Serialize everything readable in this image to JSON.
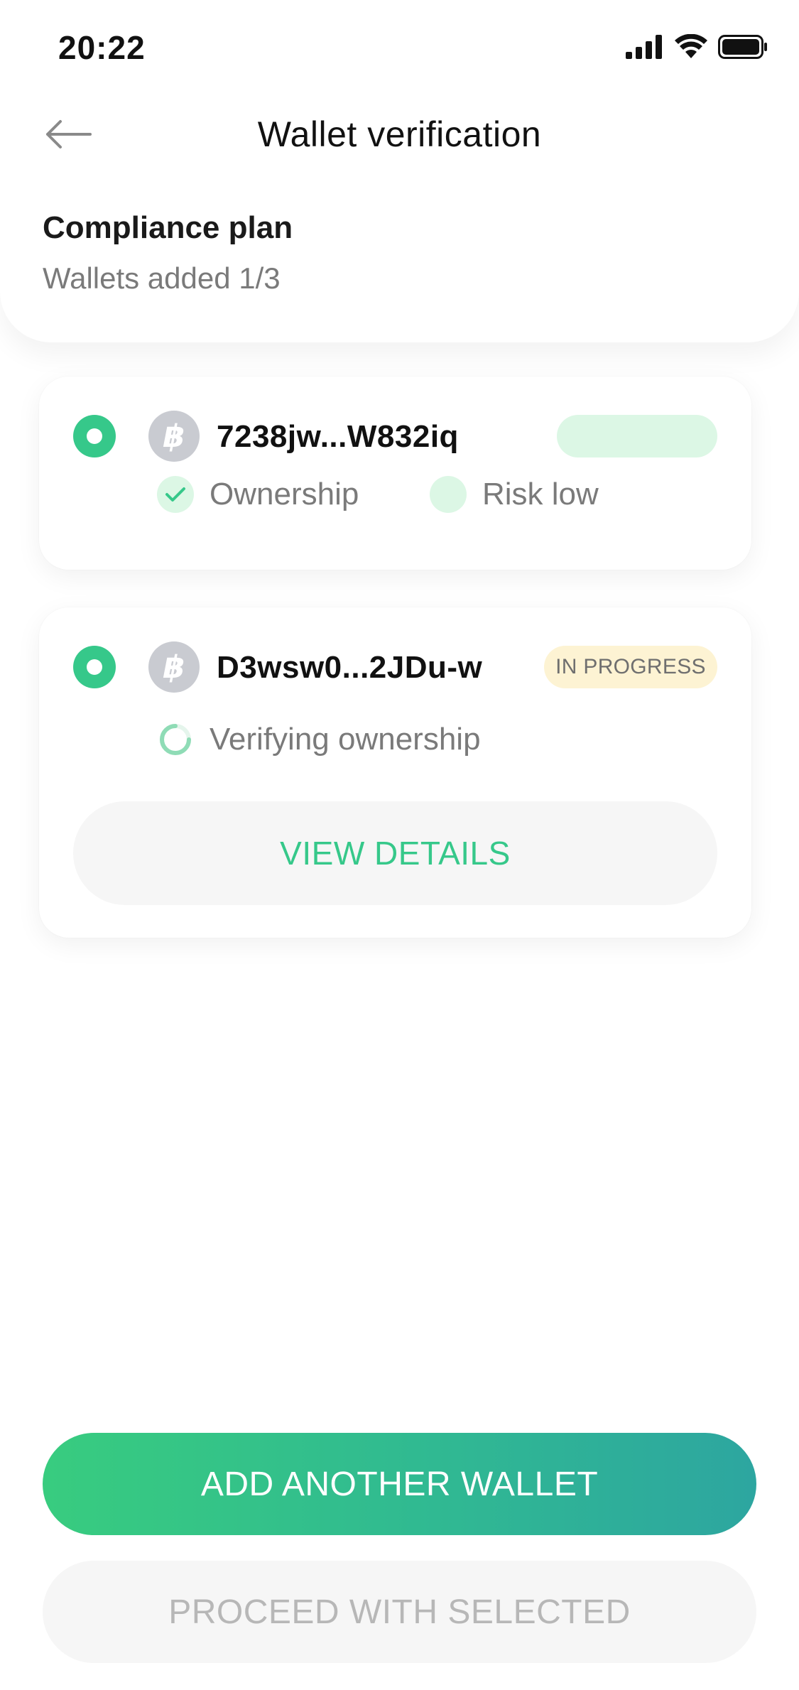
{
  "status_bar": {
    "time": "20:22",
    "icons": [
      "signal-icon",
      "wifi-icon",
      "battery-icon"
    ]
  },
  "header": {
    "back_icon": "arrow-left-icon",
    "title": "Wallet verification"
  },
  "plan": {
    "title": "Compliance plan",
    "subtitle": "Wallets added 1/3"
  },
  "wallets": [
    {
      "selected": true,
      "coin_icon": "bitcoin-icon",
      "coin_symbol": "฿",
      "address": "7238jw...W832iq",
      "status_label": "",
      "checks": [
        {
          "icon": "check-icon",
          "label": "Ownership"
        },
        {
          "icon": "risk-dot-icon",
          "label": "Risk low"
        }
      ]
    },
    {
      "selected": true,
      "coin_icon": "bitcoin-icon",
      "coin_symbol": "฿",
      "address": "D3wsw0...2JDu-w",
      "status_label": "IN PROGRESS",
      "checks": [
        {
          "icon": "spinner-icon",
          "label": "Verifying ownership"
        }
      ],
      "action_label": "VIEW DETAILS"
    }
  ],
  "actions": {
    "primary_label": "ADD ANOTHER WALLET",
    "secondary_label": "PROCEED WITH SELECTED"
  },
  "colors": {
    "accent_green": "#36c88a",
    "gradient_end": "#2da6a0",
    "pill_green": "#dcf7e5",
    "pill_yellow": "#fdf3d3",
    "muted_text": "#7a7a7a",
    "disabled_text": "#b7b7b7"
  }
}
